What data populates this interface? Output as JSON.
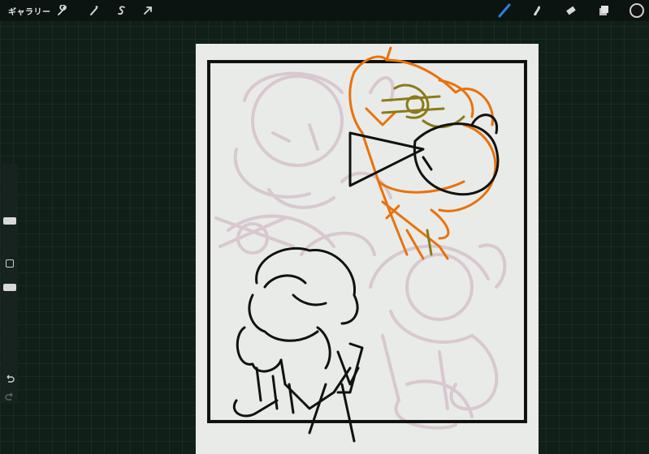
{
  "topbar": {
    "gallery_label": "ギャラリー"
  },
  "icons": {
    "actions": "wrench-icon",
    "adjustments": "magic-wand-icon",
    "selection": "selection-s-icon",
    "transform": "arrow-cursor-icon",
    "brush": "brush-icon",
    "smudge": "smudge-icon",
    "eraser": "eraser-icon",
    "layers": "layers-icon",
    "color": "color-circle-icon",
    "undo": "undo-icon",
    "redo": "redo-icon"
  },
  "colors": {
    "background": "#102019",
    "active_brush": "#2f7de1",
    "sketch_orange": "#e8720c",
    "sketch_olive": "#8a7a1a",
    "sketch_pink": "#d8c8cf",
    "ink": "#111111",
    "canvas": "#e9ebe8"
  }
}
